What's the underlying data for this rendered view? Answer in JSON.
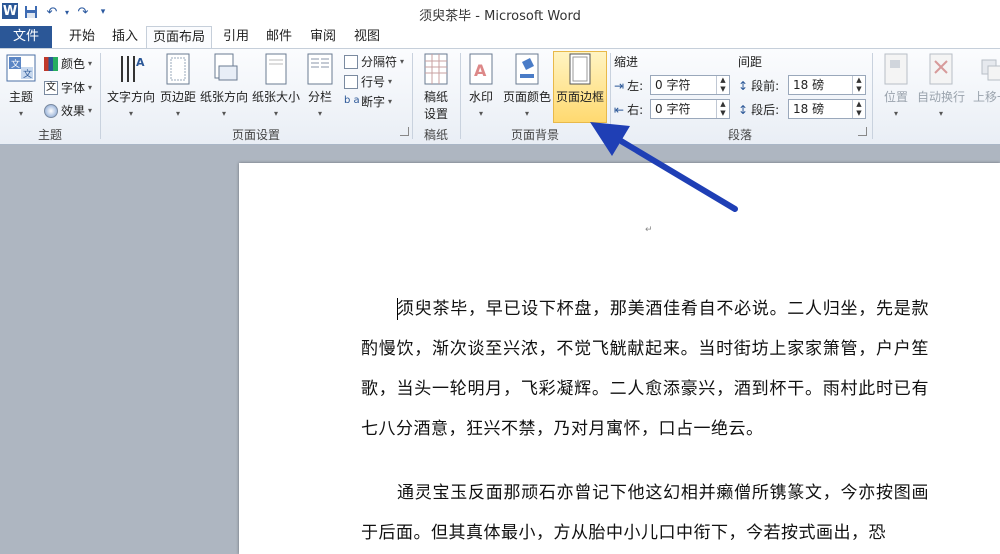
{
  "titlebar": {
    "title": "须臾茶毕 - Microsoft Word",
    "qa_icons": [
      "word-logo-icon",
      "save-icon",
      "undo-icon",
      "undo-dropdown-icon",
      "redo-icon",
      "customize-icon"
    ]
  },
  "tabs": [
    {
      "label": "文件"
    },
    {
      "label": "开始"
    },
    {
      "label": "插入"
    },
    {
      "label": "页面布局"
    },
    {
      "label": "引用"
    },
    {
      "label": "邮件"
    },
    {
      "label": "审阅"
    },
    {
      "label": "视图"
    }
  ],
  "ribbon": {
    "theme": {
      "group_label": "主题",
      "theme_btn": "主题",
      "colors": "颜色",
      "fonts": "字体",
      "effects": "效果"
    },
    "page_setup": {
      "group_label": "页面设置",
      "text_direction": "文字方向",
      "margins": "页边距",
      "orientation": "纸张方向",
      "size": "纸张大小",
      "columns": "分栏",
      "breaks": "分隔符",
      "line_numbers": "行号",
      "hyphenation": "断字"
    },
    "draft": {
      "group_label": "稿纸",
      "draft_settings_1": "稿纸",
      "draft_settings_2": "设置"
    },
    "background": {
      "group_label": "页面背景",
      "watermark": "水印",
      "page_color": "页面颜色",
      "page_borders": "页面边框"
    },
    "paragraph": {
      "group_label": "段落",
      "indent_label": "缩进",
      "left_label": "左:",
      "left_value": "0 字符",
      "right_label": "右:",
      "right_value": "0 字符",
      "spacing_label": "间距",
      "before_label": "段前:",
      "before_value": "18 磅",
      "after_label": "段后:",
      "after_value": "18 磅"
    },
    "arrange": {
      "position": "位置",
      "wrap": "自动换行",
      "bring_forward": "上移一"
    }
  },
  "document": {
    "para1": "须臾茶毕，早已设下杯盘，那美酒佳肴自不必说。二人归坐，先是款酌慢饮，渐次谈至兴浓，不觉飞觥献起来。当时街坊上家家箫管，户户笙歌，当头一轮明月，飞彩凝辉。二人愈添豪兴，酒到杯干。雨村此时已有七八分酒意，狂兴不禁，乃对月寓怀，口占一绝云。",
    "para2": "通灵宝玉反面那顽石亦曾记下他这幻相并癞僧所镌篆文，今亦按图画于后面。但其真体最小，方从胎中小儿口中衔下，今若按式画出，恐"
  },
  "colors": {
    "accent": "#2b5797",
    "arrow": "#1f3fb5",
    "highlight": "#ffd970"
  }
}
